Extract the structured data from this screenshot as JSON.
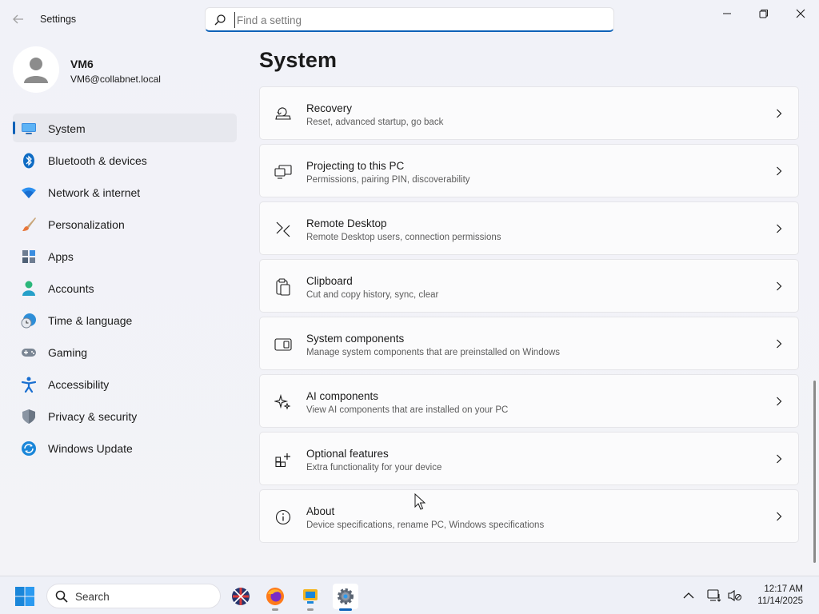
{
  "window": {
    "title": "Settings"
  },
  "search": {
    "placeholder": "Find a setting"
  },
  "profile": {
    "name": "VM6",
    "email": "VM6@collabnet.local"
  },
  "sidebar": {
    "items": [
      {
        "label": "System",
        "icon": "system-icon",
        "active": true
      },
      {
        "label": "Bluetooth & devices",
        "icon": "bluetooth-icon"
      },
      {
        "label": "Network & internet",
        "icon": "wifi-icon"
      },
      {
        "label": "Personalization",
        "icon": "brush-icon"
      },
      {
        "label": "Apps",
        "icon": "apps-icon"
      },
      {
        "label": "Accounts",
        "icon": "person-icon"
      },
      {
        "label": "Time & language",
        "icon": "clock-globe-icon"
      },
      {
        "label": "Gaming",
        "icon": "gamepad-icon"
      },
      {
        "label": "Accessibility",
        "icon": "accessibility-icon"
      },
      {
        "label": "Privacy & security",
        "icon": "shield-icon"
      },
      {
        "label": "Windows Update",
        "icon": "update-icon"
      }
    ]
  },
  "main": {
    "title": "System",
    "cards": [
      {
        "title": "Recovery",
        "desc": "Reset, advanced startup, go back",
        "icon": "recovery-icon"
      },
      {
        "title": "Projecting to this PC",
        "desc": "Permissions, pairing PIN, discoverability",
        "icon": "projecting-icon"
      },
      {
        "title": "Remote Desktop",
        "desc": "Remote Desktop users, connection permissions",
        "icon": "remote-desktop-icon"
      },
      {
        "title": "Clipboard",
        "desc": "Cut and copy history, sync, clear",
        "icon": "clipboard-icon"
      },
      {
        "title": "System components",
        "desc": "Manage system components that are preinstalled on Windows",
        "icon": "system-components-icon"
      },
      {
        "title": "AI components",
        "desc": "View AI components that are installed on your PC",
        "icon": "sparkle-icon"
      },
      {
        "title": "Optional features",
        "desc": "Extra functionality for your device",
        "icon": "optional-features-icon"
      },
      {
        "title": "About",
        "desc": "Device specifications, rename PC, Windows specifications",
        "icon": "info-icon"
      }
    ]
  },
  "taskbar": {
    "search_label": "Search",
    "apps": [
      "vpn-globe-icon",
      "firefox-icon",
      "remote-app-icon",
      "settings-gear-icon"
    ],
    "time": "12:17 AM",
    "date": "11/14/2025"
  },
  "colors": {
    "accent": "#0e62b8",
    "background": "#f3f3f7",
    "card": "#fbfbfc"
  }
}
